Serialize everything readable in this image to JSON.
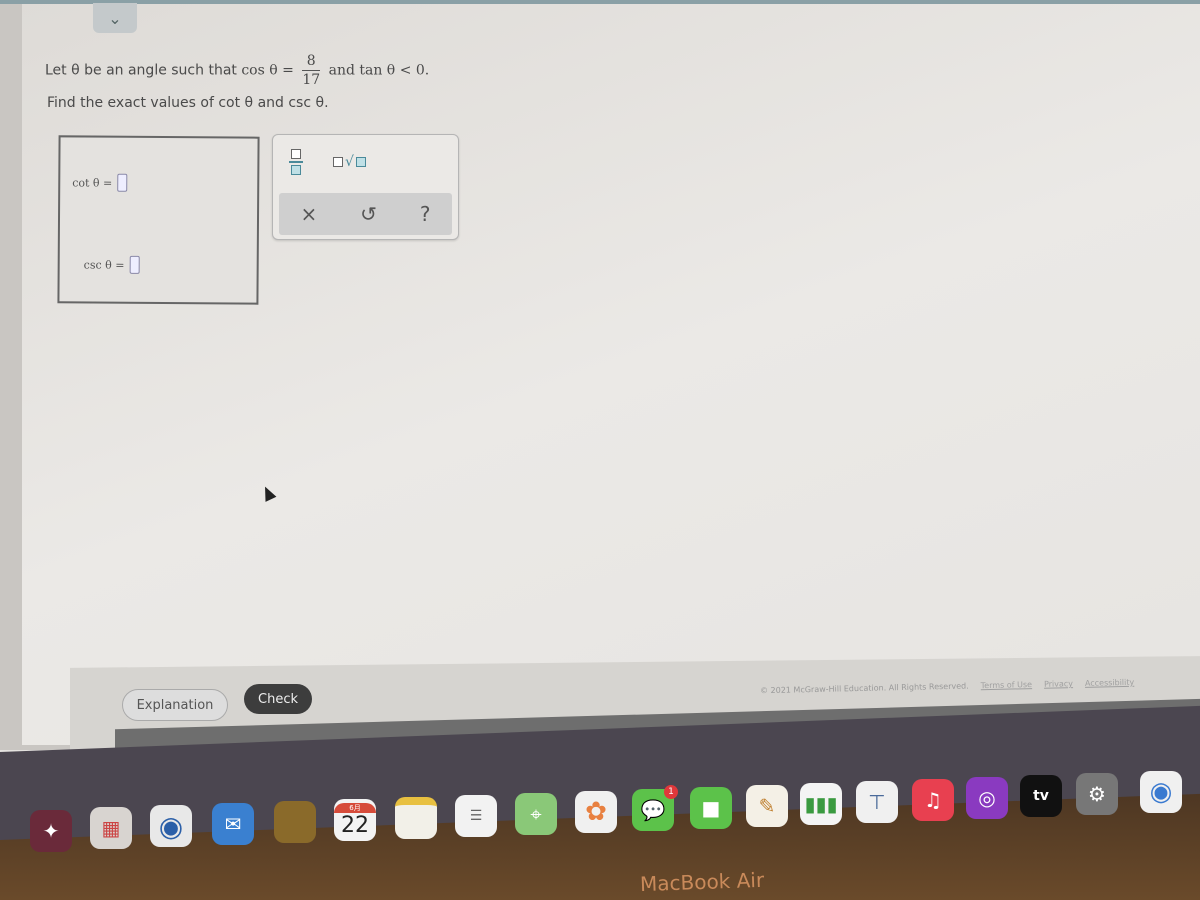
{
  "question": {
    "line1_prefix": "Let θ be an angle such that ",
    "cos_label": "cos θ =",
    "numerator": "8",
    "denominator": "17",
    "line1_suffix": "and tan θ < 0.",
    "line2": "Find the exact values of cot θ and csc θ."
  },
  "answers": [
    {
      "label": "cot θ =",
      "value": ""
    },
    {
      "label": "csc θ =",
      "value": ""
    }
  ],
  "palette": {
    "fraction_icon": "fraction-icon",
    "mixed_sqrt_icon": "coefficient-sqrt-icon",
    "clear": "×",
    "undo": "↺",
    "help": "?"
  },
  "buttons": {
    "explanation": "Explanation",
    "check": "Check"
  },
  "footer": {
    "copyright": "© 2021 McGraw-Hill Education. All Rights Reserved.",
    "terms": "Terms of Use",
    "privacy": "Privacy",
    "accessibility": "Accessibility"
  },
  "dock": {
    "apps": [
      {
        "name": "Launchpad"
      },
      {
        "name": "Photo Booth"
      },
      {
        "name": "Safari"
      },
      {
        "name": "Mail"
      },
      {
        "name": "Contacts"
      },
      {
        "name": "Calendar",
        "month": "6月",
        "day": "22"
      },
      {
        "name": "Notes"
      },
      {
        "name": "Reminders"
      },
      {
        "name": "Maps"
      },
      {
        "name": "Photos"
      },
      {
        "name": "Messages",
        "badge": "1"
      },
      {
        "name": "FaceTime"
      },
      {
        "name": "Pages"
      },
      {
        "name": "Numbers"
      },
      {
        "name": "Keynote"
      },
      {
        "name": "Music"
      },
      {
        "name": "Podcasts"
      },
      {
        "name": "TV",
        "text": "tv"
      },
      {
        "name": "System Preferences"
      },
      {
        "name": "Chrome"
      }
    ]
  },
  "device_label": "MacBook Air"
}
